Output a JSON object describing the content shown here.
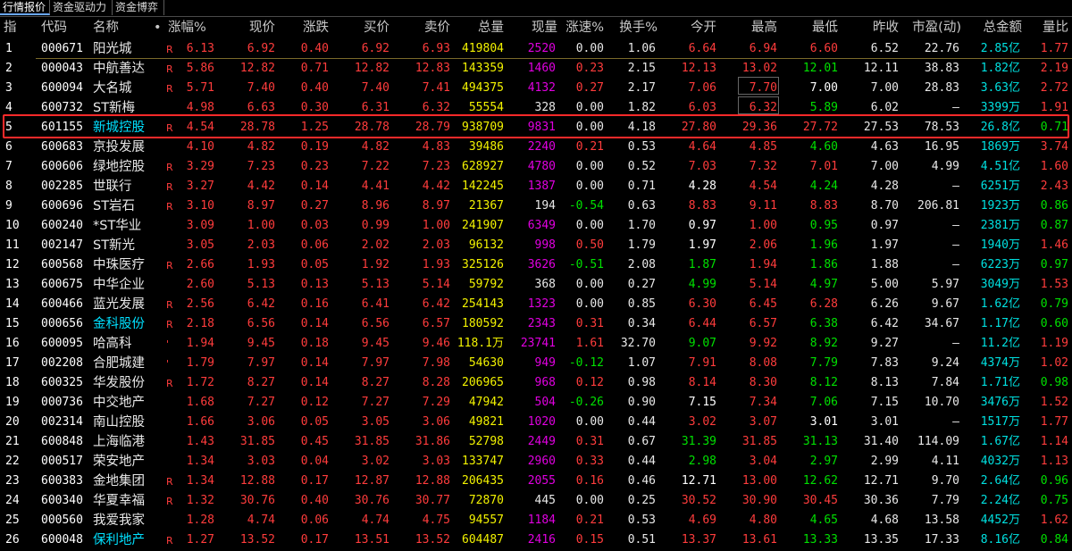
{
  "tabs": [
    "行情报价",
    "资金驱动力",
    "资金博弈"
  ],
  "headers": [
    "指",
    "代码",
    "名称",
    "•",
    "涨幅%",
    "现价",
    "涨跌",
    "买价",
    "卖价",
    "总量",
    "现量",
    "涨速%",
    "换手%",
    "今开",
    "最高",
    "最低",
    "昨收",
    "市盈(动)",
    "总金额",
    "量比"
  ],
  "sort_arrow": "↓",
  "rows": [
    [
      "1",
      "000671",
      "阳光城",
      "R",
      "6.13",
      "6.92",
      "0.40",
      "6.92",
      "6.93",
      "419804",
      "2520",
      "0.00",
      "1.06",
      "6.64",
      "6.94",
      "6.60",
      "6.52",
      "22.76",
      "2.85亿",
      "1.77"
    ],
    [
      "2",
      "000043",
      "中航善达",
      "R",
      "5.86",
      "12.82",
      "0.71",
      "12.82",
      "12.83",
      "143359",
      "1460",
      "0.23",
      "2.15",
      "12.13",
      "13.02",
      "12.01",
      "12.11",
      "38.83",
      "1.82亿",
      "2.19"
    ],
    [
      "3",
      "600094",
      "大名城",
      "R",
      "5.71",
      "7.40",
      "0.40",
      "7.40",
      "7.41",
      "494375",
      "4132",
      "0.27",
      "2.17",
      "7.06",
      "7.70",
      "7.00",
      "7.00",
      "28.83",
      "3.63亿",
      "2.72"
    ],
    [
      "4",
      "600732",
      "ST新梅",
      "",
      "4.98",
      "6.63",
      "0.30",
      "6.31",
      "6.32",
      "55554",
      "328",
      "0.00",
      "1.82",
      "6.03",
      "6.32",
      "5.89",
      "6.02",
      "–",
      "3399万",
      "1.91"
    ],
    [
      "5",
      "601155",
      "新城控股",
      "R",
      "4.54",
      "28.78",
      "1.25",
      "28.78",
      "28.79",
      "938709",
      "9831",
      "0.00",
      "4.18",
      "27.80",
      "29.36",
      "27.72",
      "27.53",
      "78.53",
      "26.8亿",
      "0.71"
    ],
    [
      "6",
      "600683",
      "京投发展",
      "",
      "4.10",
      "4.82",
      "0.19",
      "4.82",
      "4.83",
      "39486",
      "2240",
      "0.21",
      "0.53",
      "4.64",
      "4.85",
      "4.60",
      "4.63",
      "16.95",
      "1869万",
      "3.74"
    ],
    [
      "7",
      "600606",
      "绿地控股",
      "R",
      "3.29",
      "7.23",
      "0.23",
      "7.22",
      "7.23",
      "628927",
      "4780",
      "0.00",
      "0.52",
      "7.03",
      "7.32",
      "7.01",
      "7.00",
      "4.99",
      "4.51亿",
      "1.60"
    ],
    [
      "8",
      "002285",
      "世联行",
      "R",
      "3.27",
      "4.42",
      "0.14",
      "4.41",
      "4.42",
      "142245",
      "1387",
      "0.00",
      "0.71",
      "4.28",
      "4.54",
      "4.24",
      "4.28",
      "–",
      "6251万",
      "2.43"
    ],
    [
      "9",
      "600696",
      "ST岩石",
      "R",
      "3.10",
      "8.97",
      "0.27",
      "8.96",
      "8.97",
      "21367",
      "194",
      "-0.54",
      "0.63",
      "8.83",
      "9.11",
      "8.83",
      "8.70",
      "206.81",
      "1923万",
      "0.86"
    ],
    [
      "10",
      "600240",
      "*ST华业",
      "",
      "3.09",
      "1.00",
      "0.03",
      "0.99",
      "1.00",
      "241907",
      "6349",
      "0.00",
      "1.70",
      "0.97",
      "1.00",
      "0.95",
      "0.97",
      "–",
      "2381万",
      "0.87"
    ],
    [
      "11",
      "002147",
      "ST新光",
      "",
      "3.05",
      "2.03",
      "0.06",
      "2.02",
      "2.03",
      "96132",
      "998",
      "0.50",
      "1.79",
      "1.97",
      "2.06",
      "1.96",
      "1.97",
      "–",
      "1940万",
      "1.46"
    ],
    [
      "12",
      "600568",
      "中珠医疗",
      "R",
      "2.66",
      "1.93",
      "0.05",
      "1.92",
      "1.93",
      "325126",
      "3626",
      "-0.51",
      "2.08",
      "1.87",
      "1.94",
      "1.86",
      "1.88",
      "–",
      "6223万",
      "0.97"
    ],
    [
      "13",
      "600675",
      "中华企业",
      "",
      "2.60",
      "5.13",
      "0.13",
      "5.13",
      "5.14",
      "59792",
      "368",
      "0.00",
      "0.27",
      "4.99",
      "5.14",
      "4.97",
      "5.00",
      "5.97",
      "3049万",
      "1.53"
    ],
    [
      "14",
      "600466",
      "蓝光发展",
      "R",
      "2.56",
      "6.42",
      "0.16",
      "6.41",
      "6.42",
      "254143",
      "1323",
      "0.00",
      "0.85",
      "6.30",
      "6.45",
      "6.28",
      "6.26",
      "9.67",
      "1.62亿",
      "0.79"
    ],
    [
      "15",
      "000656",
      "金科股份",
      "R",
      "2.18",
      "6.56",
      "0.14",
      "6.56",
      "6.57",
      "180592",
      "2343",
      "0.31",
      "0.34",
      "6.44",
      "6.57",
      "6.38",
      "6.42",
      "34.67",
      "1.17亿",
      "0.60"
    ],
    [
      "16",
      "600095",
      "哈高科",
      "'",
      "1.94",
      "9.45",
      "0.18",
      "9.45",
      "9.46",
      "118.1万",
      "23741",
      "1.61",
      "32.70",
      "9.07",
      "9.92",
      "8.92",
      "9.27",
      "–",
      "11.2亿",
      "1.19"
    ],
    [
      "17",
      "002208",
      "合肥城建",
      "'",
      "1.79",
      "7.97",
      "0.14",
      "7.97",
      "7.98",
      "54630",
      "949",
      "-0.12",
      "1.07",
      "7.91",
      "8.08",
      "7.79",
      "7.83",
      "9.24",
      "4374万",
      "1.02"
    ],
    [
      "18",
      "600325",
      "华发股份",
      "R",
      "1.72",
      "8.27",
      "0.14",
      "8.27",
      "8.28",
      "206965",
      "968",
      "0.12",
      "0.98",
      "8.14",
      "8.30",
      "8.12",
      "8.13",
      "7.84",
      "1.71亿",
      "0.98"
    ],
    [
      "19",
      "000736",
      "中交地产",
      "",
      "1.68",
      "7.27",
      "0.12",
      "7.27",
      "7.29",
      "47942",
      "504",
      "-0.26",
      "0.90",
      "7.15",
      "7.34",
      "7.06",
      "7.15",
      "10.70",
      "3476万",
      "1.52"
    ],
    [
      "20",
      "002314",
      "南山控股",
      "",
      "1.66",
      "3.06",
      "0.05",
      "3.05",
      "3.06",
      "49821",
      "1020",
      "0.00",
      "0.44",
      "3.02",
      "3.07",
      "3.01",
      "3.01",
      "–",
      "1517万",
      "1.77"
    ],
    [
      "21",
      "600848",
      "上海临港",
      "",
      "1.43",
      "31.85",
      "0.45",
      "31.85",
      "31.86",
      "52798",
      "2449",
      "0.31",
      "0.67",
      "31.39",
      "31.85",
      "31.13",
      "31.40",
      "114.09",
      "1.67亿",
      "1.14"
    ],
    [
      "22",
      "000517",
      "荣安地产",
      "",
      "1.34",
      "3.03",
      "0.04",
      "3.02",
      "3.03",
      "133747",
      "2960",
      "0.33",
      "0.44",
      "2.98",
      "3.04",
      "2.97",
      "2.99",
      "4.11",
      "4032万",
      "1.13"
    ],
    [
      "23",
      "600383",
      "金地集团",
      "R",
      "1.34",
      "12.88",
      "0.17",
      "12.87",
      "12.88",
      "206435",
      "2055",
      "0.16",
      "0.46",
      "12.71",
      "13.00",
      "12.62",
      "12.71",
      "9.70",
      "2.64亿",
      "0.96"
    ],
    [
      "24",
      "600340",
      "华夏幸福",
      "R",
      "1.32",
      "30.76",
      "0.40",
      "30.76",
      "30.77",
      "72870",
      "445",
      "0.00",
      "0.25",
      "30.52",
      "30.90",
      "30.45",
      "30.36",
      "7.79",
      "2.24亿",
      "0.75"
    ],
    [
      "25",
      "000560",
      "我爱我家",
      "",
      "1.28",
      "4.74",
      "0.06",
      "4.74",
      "4.75",
      "94557",
      "1184",
      "0.21",
      "0.53",
      "4.69",
      "4.80",
      "4.65",
      "4.68",
      "13.58",
      "4452万",
      "1.62"
    ],
    [
      "26",
      "600048",
      "保利地产",
      "R",
      "1.27",
      "13.52",
      "0.17",
      "13.51",
      "13.52",
      "604487",
      "2416",
      "0.15",
      "0.51",
      "13.37",
      "13.61",
      "13.33",
      "13.35",
      "17.33",
      "8.16亿",
      "0.84"
    ]
  ],
  "colors": {
    "background": "#000000",
    "up": "#ff3c3c",
    "down": "#00e000",
    "flat": "#e8e8e8",
    "volume": "#f2f200",
    "current_volume": "#e000e0",
    "amount": "#00e0e0",
    "name_highlight": "#00e0ff",
    "selection_border": "#ff2a2a"
  }
}
